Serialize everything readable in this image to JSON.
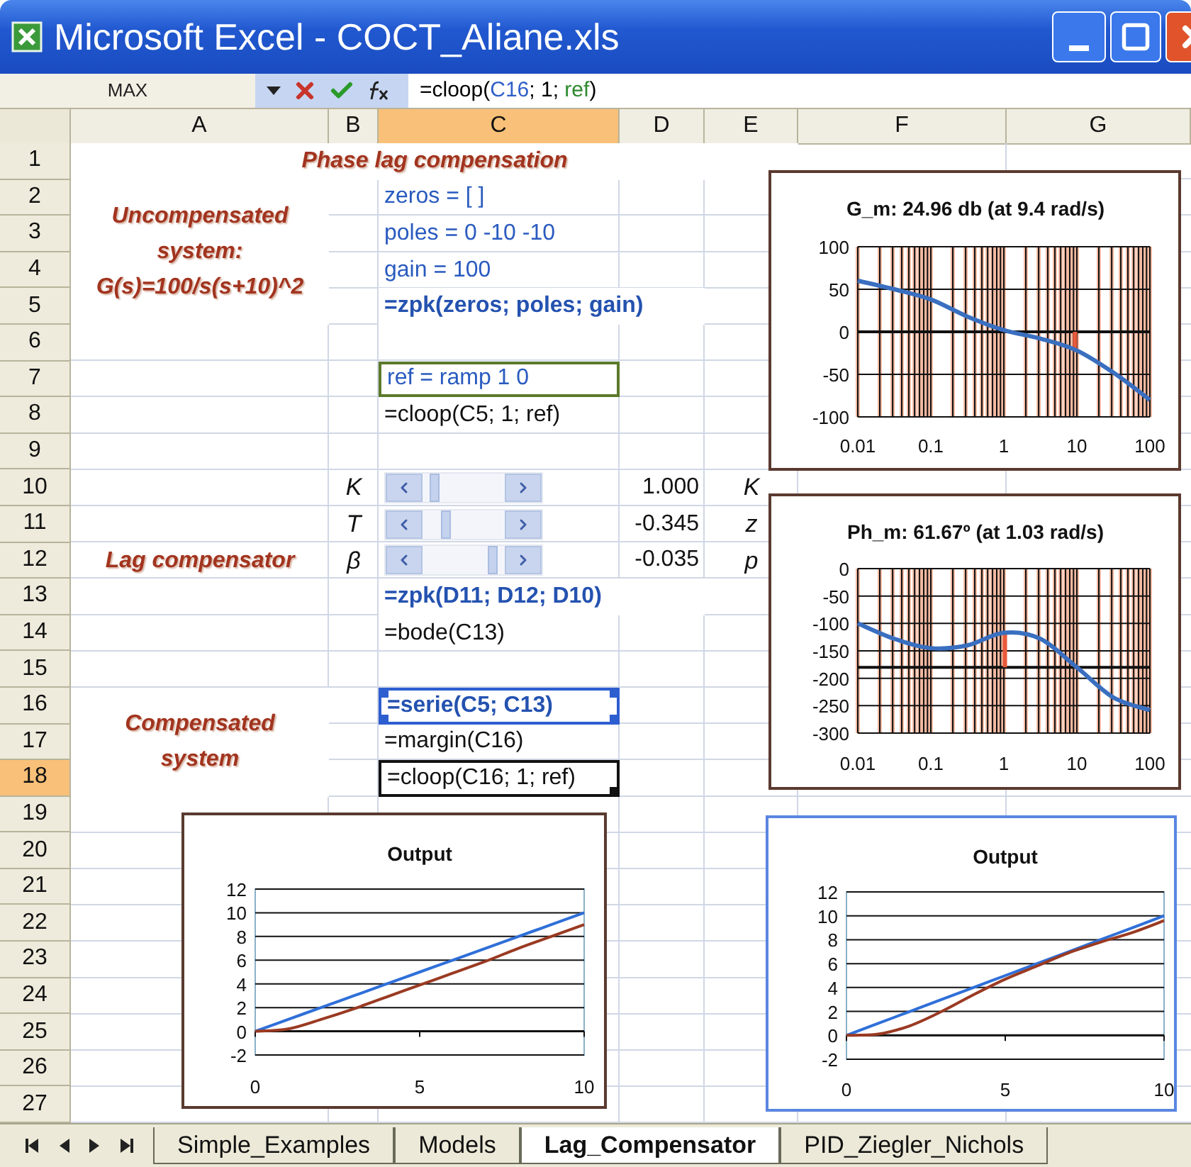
{
  "window": {
    "title": "Microsoft Excel - COCT_Aliane.xls"
  },
  "formula_bar": {
    "name_box": "MAX",
    "formula": [
      {
        "text": "=cloop(",
        "color": "#000000"
      },
      {
        "text": "C16",
        "color": "#2f5fc8"
      },
      {
        "text": "; 1; ",
        "color": "#000000"
      },
      {
        "text": "ref",
        "color": "#2e8a2e"
      },
      {
        "text": ")",
        "color": "#000000"
      }
    ]
  },
  "columns": [
    {
      "label": "A",
      "selected": false
    },
    {
      "label": "B",
      "selected": false
    },
    {
      "label": "C",
      "selected": true
    },
    {
      "label": "D",
      "selected": false
    },
    {
      "label": "E",
      "selected": false
    },
    {
      "label": "F",
      "selected": false
    },
    {
      "label": "G",
      "selected": false
    }
  ],
  "rows": [
    {
      "label": "1",
      "selected": false
    },
    {
      "label": "2",
      "selected": false
    },
    {
      "label": "3",
      "selected": false
    },
    {
      "label": "4",
      "selected": false
    },
    {
      "label": "5",
      "selected": false
    },
    {
      "label": "6",
      "selected": false
    },
    {
      "label": "7",
      "selected": false
    },
    {
      "label": "8",
      "selected": false
    },
    {
      "label": "9",
      "selected": false
    },
    {
      "label": "10",
      "selected": false
    },
    {
      "label": "11",
      "selected": false
    },
    {
      "label": "12",
      "selected": false
    },
    {
      "label": "13",
      "selected": false
    },
    {
      "label": "14",
      "selected": false
    },
    {
      "label": "15",
      "selected": false
    },
    {
      "label": "16",
      "selected": false
    },
    {
      "label": "17",
      "selected": false
    },
    {
      "label": "18",
      "selected": true
    },
    {
      "label": "19",
      "selected": false
    },
    {
      "label": "20",
      "selected": false
    },
    {
      "label": "21",
      "selected": false
    },
    {
      "label": "22",
      "selected": false
    },
    {
      "label": "23",
      "selected": false
    },
    {
      "label": "24",
      "selected": false
    },
    {
      "label": "25",
      "selected": false
    },
    {
      "label": "26",
      "selected": false
    },
    {
      "label": "27",
      "selected": false
    }
  ],
  "cells": [
    {
      "kind": "heading",
      "text": "Phase lag compensation",
      "outlined": false,
      "referenced": false,
      "active": false
    },
    {
      "kind": "heading",
      "text": "Uncompensated\nsystem:\nG(s)=100/s(s+10)^2",
      "outlined": false,
      "referenced": false,
      "active": false
    },
    {
      "kind": "input",
      "text": "zeros = [ ]",
      "outlined": false,
      "referenced": false,
      "active": false
    },
    {
      "kind": "input",
      "text": "poles = 0 -10 -10",
      "outlined": false,
      "referenced": false,
      "active": false
    },
    {
      "kind": "input",
      "text": "gain = 100",
      "outlined": false,
      "referenced": false,
      "active": false
    },
    {
      "kind": "formula_bold",
      "text": "=zpk(zeros; poles; gain)",
      "outlined": false,
      "referenced": false,
      "active": false
    },
    {
      "kind": "input",
      "text": "ref = ramp 1 0",
      "outlined": true,
      "referenced": false,
      "active": false
    },
    {
      "kind": "formula",
      "text": "=cloop(C5; 1; ref)",
      "outlined": false,
      "referenced": false,
      "active": false
    },
    {
      "kind": "symbol",
      "text": "K",
      "outlined": false,
      "referenced": false,
      "active": false
    },
    {
      "kind": "scrollbar",
      "outlined": false,
      "referenced": false,
      "active": false
    },
    {
      "kind": "number",
      "text": "1.000",
      "outlined": false,
      "referenced": false,
      "active": false
    },
    {
      "kind": "symbol",
      "text": "K",
      "outlined": false,
      "referenced": false,
      "active": false
    },
    {
      "kind": "symbol",
      "text": "T",
      "outlined": false,
      "referenced": false,
      "active": false
    },
    {
      "kind": "scrollbar",
      "outlined": false,
      "referenced": false,
      "active": false
    },
    {
      "kind": "number",
      "text": "-0.345",
      "outlined": false,
      "referenced": false,
      "active": false
    },
    {
      "kind": "symbol",
      "text": "z",
      "outlined": false,
      "referenced": false,
      "active": false
    },
    {
      "kind": "heading",
      "text": "Lag compensator",
      "outlined": false,
      "referenced": false,
      "active": false
    },
    {
      "kind": "symbol",
      "text": "β",
      "outlined": false,
      "referenced": false,
      "active": false
    },
    {
      "kind": "scrollbar",
      "outlined": false,
      "referenced": false,
      "active": false
    },
    {
      "kind": "number",
      "text": "-0.035",
      "outlined": false,
      "referenced": false,
      "active": false
    },
    {
      "kind": "symbol",
      "text": "p",
      "outlined": false,
      "referenced": false,
      "active": false
    },
    {
      "kind": "formula_bold",
      "text": "=zpk(D11; D12; D10)",
      "outlined": false,
      "referenced": false,
      "active": false
    },
    {
      "kind": "formula",
      "text": "=bode(C13)",
      "outlined": false,
      "referenced": false,
      "active": false
    },
    {
      "kind": "heading",
      "text": "Compensated\nsystem",
      "outlined": false,
      "referenced": false,
      "active": false
    },
    {
      "kind": "formula_bold",
      "text": "=serie(C5; C13)",
      "outlined": false,
      "referenced": true,
      "active": false
    },
    {
      "kind": "formula",
      "text": "=margin(C16)",
      "outlined": false,
      "referenced": false,
      "active": false
    },
    {
      "kind": "formula",
      "text": "=cloop(C16; 1; ref)",
      "outlined": false,
      "referenced": false,
      "active": true
    }
  ],
  "charts": [
    {
      "selected": false,
      "chart_data": {
        "type": "line",
        "title": "G_m: 24.96 db (at 9.4 rad/s)",
        "grid": "both",
        "categories": [
          "0.01",
          null,
          "0.1",
          null,
          "1",
          null,
          "10",
          null,
          "100"
        ],
        "series": [
          {
            "color": "#3a6fc0",
            "values": [
              60,
              50,
              38,
              18,
              2,
              -8,
              -22,
              -48,
              -80
            ]
          }
        ],
        "ylim": [
          -100,
          100
        ],
        "yticks": [
          {
            "value": -100,
            "label": "-100"
          },
          {
            "value": -50,
            "label": "-50"
          },
          {
            "value": 0,
            "label": "0"
          },
          {
            "value": 50,
            "label": "50"
          },
          {
            "value": 100,
            "label": "100"
          }
        ],
        "ref_lines": [
          {
            "axis": "y",
            "value": 0
          }
        ]
      }
    },
    {
      "selected": false,
      "chart_data": {
        "type": "line",
        "title": "Ph_m: 61.67º (at 1.03 rad/s)",
        "grid": "both",
        "categories": [
          "0.01",
          null,
          "0.1",
          null,
          "1",
          null,
          "10",
          null,
          "100"
        ],
        "series": [
          {
            "color": "#3a6fc0",
            "values": [
              -100,
              -128,
              -145,
              -140,
              -117,
              -128,
              -180,
              -235,
              -258
            ]
          }
        ],
        "ylim": [
          -300,
          0
        ],
        "yticks": [
          {
            "value": -300,
            "label": "-300"
          },
          {
            "value": -250,
            "label": "-250"
          },
          {
            "value": -200,
            "label": "-200"
          },
          {
            "value": -150,
            "label": "-150"
          },
          {
            "value": -100,
            "label": "-100"
          },
          {
            "value": -50,
            "label": "-50"
          },
          {
            "value": 0,
            "label": "0"
          }
        ],
        "ref_lines": [
          {
            "axis": "y",
            "value": -180
          }
        ]
      }
    },
    {
      "selected": false,
      "chart_data": {
        "type": "line",
        "title": "Output",
        "grid": "y",
        "x": [
          0,
          1,
          2,
          3,
          4,
          5,
          6,
          7,
          8,
          9,
          10
        ],
        "series": [
          {
            "color": "#2f6fd8",
            "values": [
              0,
              1,
              2,
              3,
              4,
              5,
              6,
              7,
              8,
              9,
              10
            ]
          },
          {
            "color": "#9a3a22",
            "values": [
              0,
              0.2,
              1,
              1.9,
              2.9,
              3.9,
              4.9,
              5.9,
              7,
              8,
              9
            ]
          }
        ],
        "xlim": [
          0,
          10
        ],
        "ylim": [
          -2,
          12
        ],
        "xticks": [
          {
            "value": 0,
            "label": "0"
          },
          {
            "value": 5,
            "label": "5"
          },
          {
            "value": 10,
            "label": "10"
          }
        ],
        "yticks": [
          {
            "value": -2,
            "label": "-2"
          },
          {
            "value": 0,
            "label": "0"
          },
          {
            "value": 2,
            "label": "2"
          },
          {
            "value": 4,
            "label": "4"
          },
          {
            "value": 6,
            "label": "6"
          },
          {
            "value": 8,
            "label": "8"
          },
          {
            "value": 10,
            "label": "10"
          },
          {
            "value": 12,
            "label": "12"
          }
        ]
      }
    },
    {
      "selected": true,
      "chart_data": {
        "type": "line",
        "title": "Output",
        "grid": "y",
        "x": [
          0,
          1,
          2,
          3,
          4,
          5,
          6,
          7,
          8,
          9,
          10
        ],
        "series": [
          {
            "color": "#2f6fd8",
            "values": [
              0,
              1,
              2,
              3,
              4,
              5,
              6,
              7,
              8,
              9,
              10
            ]
          },
          {
            "color": "#9a3a22",
            "values": [
              0,
              0.1,
              0.8,
              2,
              3.4,
              4.7,
              5.8,
              6.9,
              7.8,
              8.6,
              9.6
            ]
          }
        ],
        "xlim": [
          0,
          10
        ],
        "ylim": [
          -2,
          12
        ],
        "xticks": [
          {
            "value": 0,
            "label": "0"
          },
          {
            "value": 5,
            "label": "5"
          },
          {
            "value": 10,
            "label": "10"
          }
        ],
        "yticks": [
          {
            "value": -2,
            "label": "-2"
          },
          {
            "value": 0,
            "label": "0"
          },
          {
            "value": 2,
            "label": "2"
          },
          {
            "value": 4,
            "label": "4"
          },
          {
            "value": 6,
            "label": "6"
          },
          {
            "value": 8,
            "label": "8"
          },
          {
            "value": 10,
            "label": "10"
          },
          {
            "value": 12,
            "label": "12"
          }
        ]
      }
    }
  ],
  "sheet_tabs": [
    {
      "label": "Simple_Examples",
      "selected": false
    },
    {
      "label": "Models",
      "selected": false
    },
    {
      "label": "Lag_Compensator",
      "selected": true
    },
    {
      "label": "PID_Ziegler_Nichols",
      "selected": false
    }
  ]
}
